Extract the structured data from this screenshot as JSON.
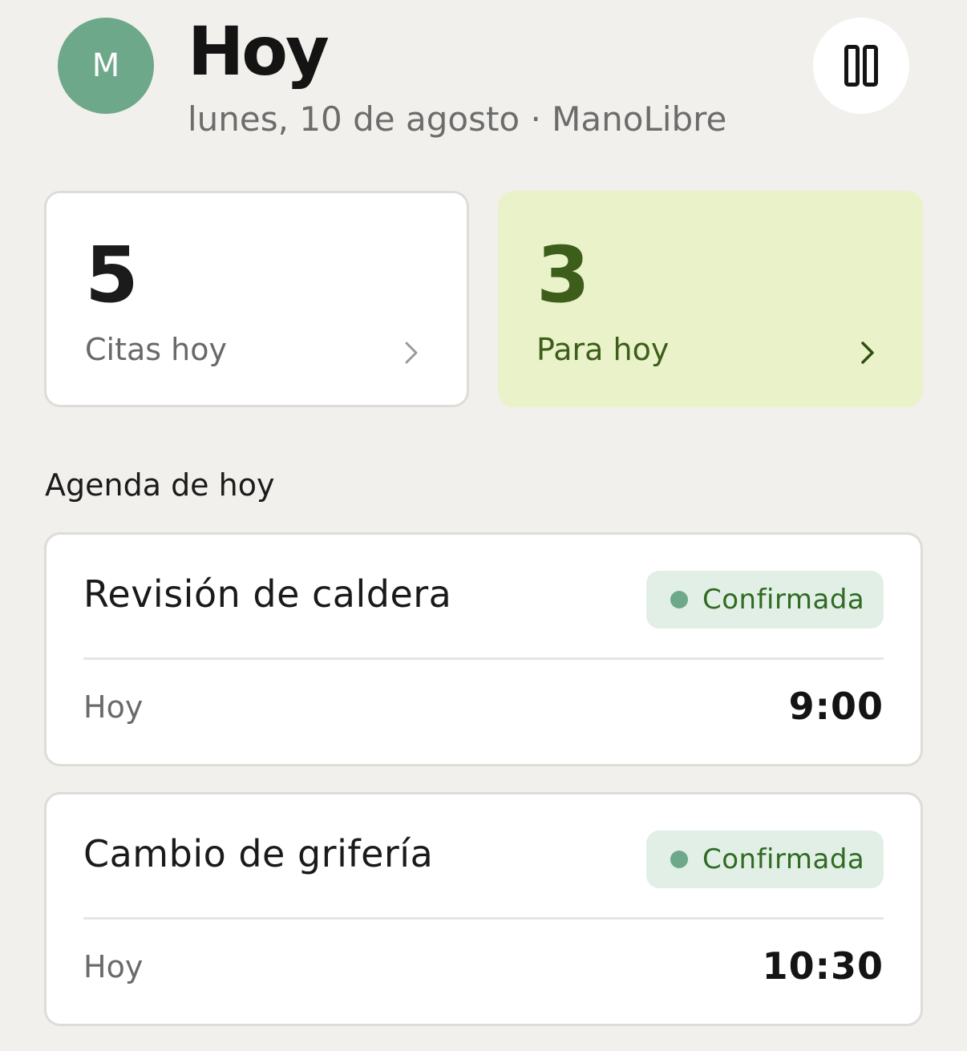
{
  "header": {
    "avatar_initial": "M",
    "title": "Hoy",
    "subtitle": "lunes, 10 de agosto · ManoLibre",
    "menu_icon": "columns-icon"
  },
  "stats": [
    {
      "value": "5",
      "label": "Citas hoy",
      "icon": "chevron-right-icon"
    },
    {
      "value": "3",
      "label": "Para hoy",
      "icon": "chevron-right-icon"
    }
  ],
  "agenda": {
    "section_title": "Agenda de hoy",
    "items": [
      {
        "title": "Revisión de caldera",
        "status": "Confirmada",
        "day": "Hoy",
        "time": "9:00"
      },
      {
        "title": "Cambio de grifería",
        "status": "Confirmada",
        "day": "Hoy",
        "time": "10:30"
      }
    ]
  },
  "colors": {
    "background": "#f1f0ec",
    "accent_green": "#6ea88a",
    "highlight_card": "#e9f2c9",
    "highlight_text": "#3c5e1a",
    "badge_bg": "#e2efe6",
    "badge_text": "#2f6b22"
  }
}
